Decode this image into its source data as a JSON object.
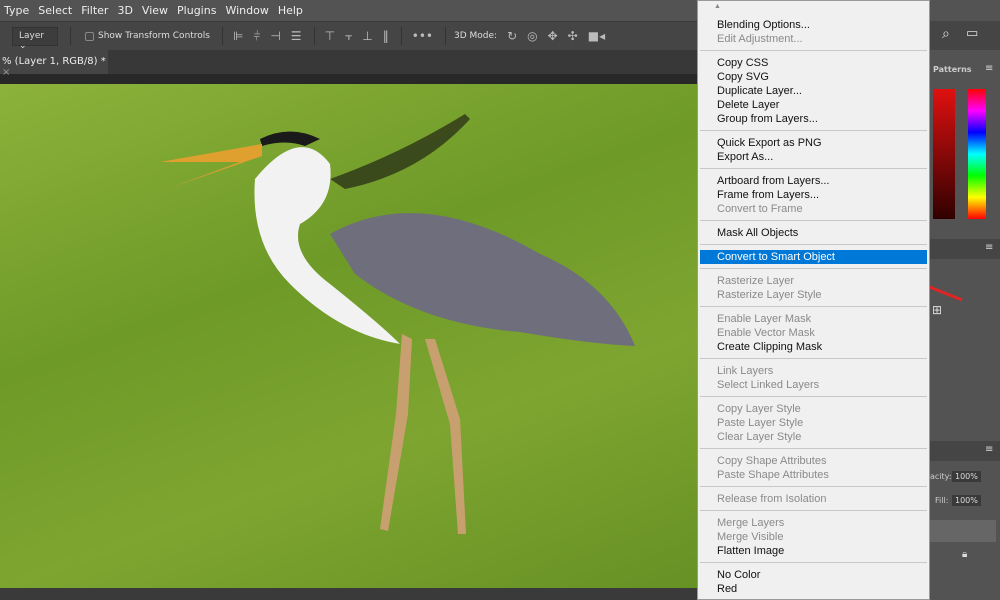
{
  "menubar": [
    "Type",
    "Select",
    "Filter",
    "3D",
    "View",
    "Plugins",
    "Window",
    "Help"
  ],
  "options": {
    "select": "Layer",
    "show_transform": "Show Transform Controls",
    "more": "•••",
    "mode3d": "3D Mode:"
  },
  "doc_tab": "% (Layer 1, RGB/8) *",
  "right_panel": {
    "patterns": "Patterns",
    "opacity_label": "acity:",
    "opacity": "100%",
    "fill_label": "Fill:",
    "fill": "100%"
  },
  "context_menu": {
    "groups": [
      [
        {
          "label": "Blending Options...",
          "enabled": true
        },
        {
          "label": "Edit Adjustment...",
          "enabled": false
        }
      ],
      [
        {
          "label": "Copy CSS",
          "enabled": true
        },
        {
          "label": "Copy SVG",
          "enabled": true
        },
        {
          "label": "Duplicate Layer...",
          "enabled": true
        },
        {
          "label": "Delete Layer",
          "enabled": true
        },
        {
          "label": "Group from Layers...",
          "enabled": true
        }
      ],
      [
        {
          "label": "Quick Export as PNG",
          "enabled": true
        },
        {
          "label": "Export As...",
          "enabled": true
        }
      ],
      [
        {
          "label": "Artboard from Layers...",
          "enabled": true
        },
        {
          "label": "Frame from Layers...",
          "enabled": true
        },
        {
          "label": "Convert to Frame",
          "enabled": false
        }
      ],
      [
        {
          "label": "Mask All Objects",
          "enabled": true
        }
      ],
      [
        {
          "label": "Convert to Smart Object",
          "enabled": true,
          "highlighted": true
        }
      ],
      [
        {
          "label": "Rasterize Layer",
          "enabled": false
        },
        {
          "label": "Rasterize Layer Style",
          "enabled": false
        }
      ],
      [
        {
          "label": "Enable Layer Mask",
          "enabled": false
        },
        {
          "label": "Enable Vector Mask",
          "enabled": false
        },
        {
          "label": "Create Clipping Mask",
          "enabled": true
        }
      ],
      [
        {
          "label": "Link Layers",
          "enabled": false
        },
        {
          "label": "Select Linked Layers",
          "enabled": false
        }
      ],
      [
        {
          "label": "Copy Layer Style",
          "enabled": false
        },
        {
          "label": "Paste Layer Style",
          "enabled": false
        },
        {
          "label": "Clear Layer Style",
          "enabled": false
        }
      ],
      [
        {
          "label": "Copy Shape Attributes",
          "enabled": false
        },
        {
          "label": "Paste Shape Attributes",
          "enabled": false
        }
      ],
      [
        {
          "label": "Release from Isolation",
          "enabled": false
        }
      ],
      [
        {
          "label": "Merge Layers",
          "enabled": false
        },
        {
          "label": "Merge Visible",
          "enabled": false
        },
        {
          "label": "Flatten Image",
          "enabled": true
        }
      ],
      [
        {
          "label": "No Color",
          "enabled": true
        },
        {
          "label": "Red",
          "enabled": true
        }
      ]
    ]
  },
  "colors": {
    "highlight": "#0078d7",
    "arrow": "#e02424"
  }
}
